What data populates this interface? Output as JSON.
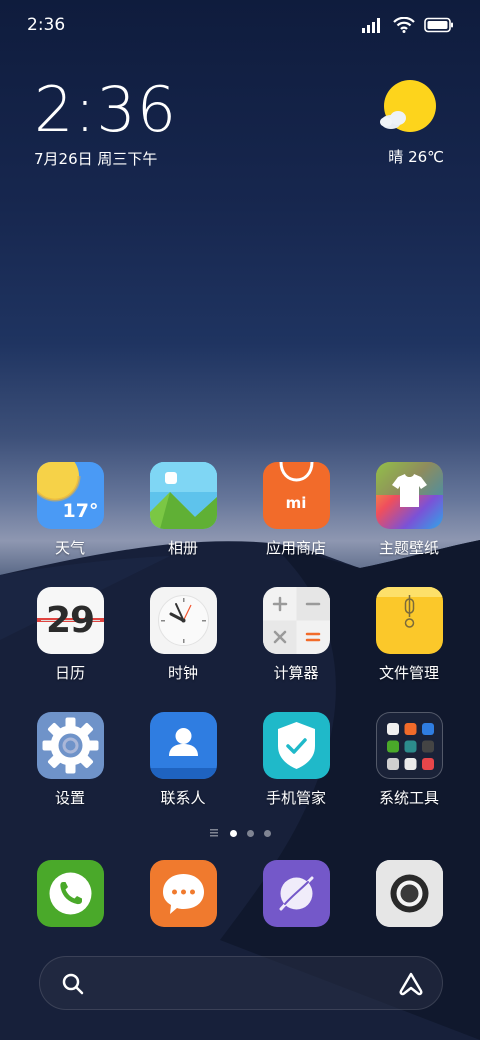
{
  "status_bar": {
    "time": "2:36"
  },
  "clock_widget": {
    "time": "2:36",
    "date": "7月26日 周三下午"
  },
  "weather_widget": {
    "text": "晴 26℃"
  },
  "apps": [
    {
      "name": "weather-app",
      "icon": "weather-icon",
      "label": "天气",
      "icon_text": "17°"
    },
    {
      "name": "gallery-app",
      "icon": "gallery-icon",
      "label": "相册"
    },
    {
      "name": "app-store-app",
      "icon": "shopping-bag-icon",
      "label": "应用商店",
      "icon_text": "mi"
    },
    {
      "name": "themes-app",
      "icon": "tshirt-icon",
      "label": "主题壁纸"
    },
    {
      "name": "calendar-app",
      "icon": "calendar-icon",
      "label": "日历",
      "icon_text": "29"
    },
    {
      "name": "clock-app",
      "icon": "clock-icon",
      "label": "时钟"
    },
    {
      "name": "calculator-app",
      "icon": "calculator-icon",
      "label": "计算器"
    },
    {
      "name": "file-manager-app",
      "icon": "folder-icon",
      "label": "文件管理"
    },
    {
      "name": "settings-app",
      "icon": "gear-icon",
      "label": "设置"
    },
    {
      "name": "contacts-app",
      "icon": "contacts-icon",
      "label": "联系人"
    },
    {
      "name": "security-app",
      "icon": "shield-icon",
      "label": "手机管家"
    },
    {
      "name": "tools-folder",
      "icon": "folder-grid-icon",
      "label": "系统工具"
    }
  ],
  "dock": [
    {
      "name": "phone-app",
      "icon": "phone-icon"
    },
    {
      "name": "messages-app",
      "icon": "message-icon"
    },
    {
      "name": "browser-app",
      "icon": "browser-icon"
    },
    {
      "name": "camera-app",
      "icon": "camera-icon"
    }
  ],
  "pages": {
    "count": 3,
    "current": 1
  },
  "colors": {
    "weather_bg": "#4a9af5",
    "gallery_bg": "#62c6ee",
    "store_bg": "#f26b2a",
    "calculator_bg": "#f2f2f2",
    "files_bg": "#fbc82a",
    "settings_bg": "#6f93c9",
    "contacts_bg": "#2f7de1",
    "security_bg": "#1fb9c9",
    "phone_bg": "#4aa92a",
    "messages_bg": "#f07a2e",
    "browser_bg": "#7458c9",
    "camera_bg": "#dddddd"
  }
}
